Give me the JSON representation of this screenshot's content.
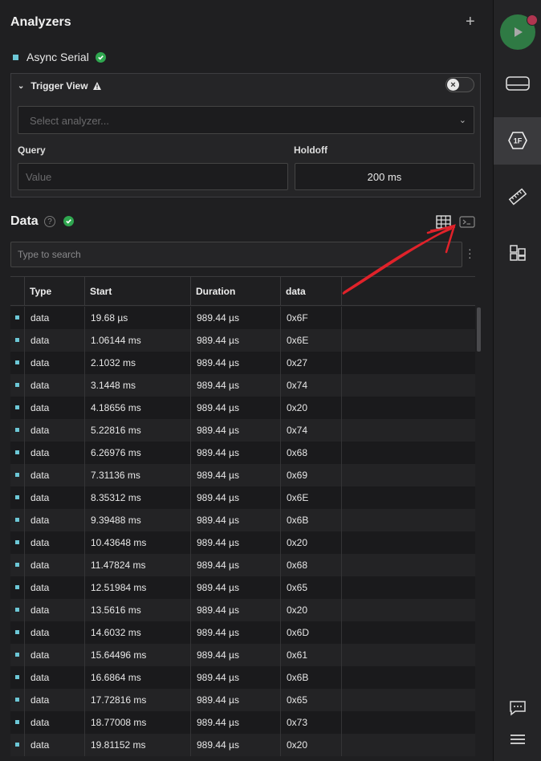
{
  "header": {
    "title": "Analyzers"
  },
  "analyzer": {
    "name": "Async Serial"
  },
  "trigger": {
    "title": "Trigger View",
    "select_placeholder": "Select analyzer...",
    "query_label": "Query",
    "query_placeholder": "Value",
    "holdoff_label": "Holdoff",
    "holdoff_value": "200 ms"
  },
  "data_section": {
    "title": "Data",
    "help": "?",
    "search_placeholder": "Type to search"
  },
  "table": {
    "columns": [
      "Type",
      "Start",
      "Duration",
      "data"
    ],
    "rows": [
      [
        "data",
        "19.68 µs",
        "989.44 µs",
        "0x6F"
      ],
      [
        "data",
        "1.06144 ms",
        "989.44 µs",
        "0x6E"
      ],
      [
        "data",
        "2.1032 ms",
        "989.44 µs",
        "0x27"
      ],
      [
        "data",
        "3.1448 ms",
        "989.44 µs",
        "0x74"
      ],
      [
        "data",
        "4.18656 ms",
        "989.44 µs",
        "0x20"
      ],
      [
        "data",
        "5.22816 ms",
        "989.44 µs",
        "0x74"
      ],
      [
        "data",
        "6.26976 ms",
        "989.44 µs",
        "0x68"
      ],
      [
        "data",
        "7.31136 ms",
        "989.44 µs",
        "0x69"
      ],
      [
        "data",
        "8.35312 ms",
        "989.44 µs",
        "0x6E"
      ],
      [
        "data",
        "9.39488 ms",
        "989.44 µs",
        "0x6B"
      ],
      [
        "data",
        "10.43648 ms",
        "989.44 µs",
        "0x20"
      ],
      [
        "data",
        "11.47824 ms",
        "989.44 µs",
        "0x68"
      ],
      [
        "data",
        "12.51984 ms",
        "989.44 µs",
        "0x65"
      ],
      [
        "data",
        "13.5616 ms",
        "989.44 µs",
        "0x20"
      ],
      [
        "data",
        "14.6032 ms",
        "989.44 µs",
        "0x6D"
      ],
      [
        "data",
        "15.64496 ms",
        "989.44 µs",
        "0x61"
      ],
      [
        "data",
        "16.6864 ms",
        "989.44 µs",
        "0x6B"
      ],
      [
        "data",
        "17.72816 ms",
        "989.44 µs",
        "0x65"
      ],
      [
        "data",
        "18.77008 ms",
        "989.44 µs",
        "0x73"
      ],
      [
        "data",
        "19.81152 ms",
        "989.44 µs",
        "0x20"
      ]
    ]
  },
  "rightbar": {
    "items": [
      "play-icon",
      "device-icon",
      "analyzer-icon",
      "measure-icon",
      "extensions-icon",
      "chat-icon",
      "menu-icon"
    ],
    "active": "analyzer-icon",
    "analyzer_badge": "1F"
  },
  "colors": {
    "accent": "#6cc7d6",
    "success": "#2fa64f",
    "play": "#2f7a44",
    "record_dot": "#b03550",
    "annotation_arrow": "#e0222a"
  }
}
